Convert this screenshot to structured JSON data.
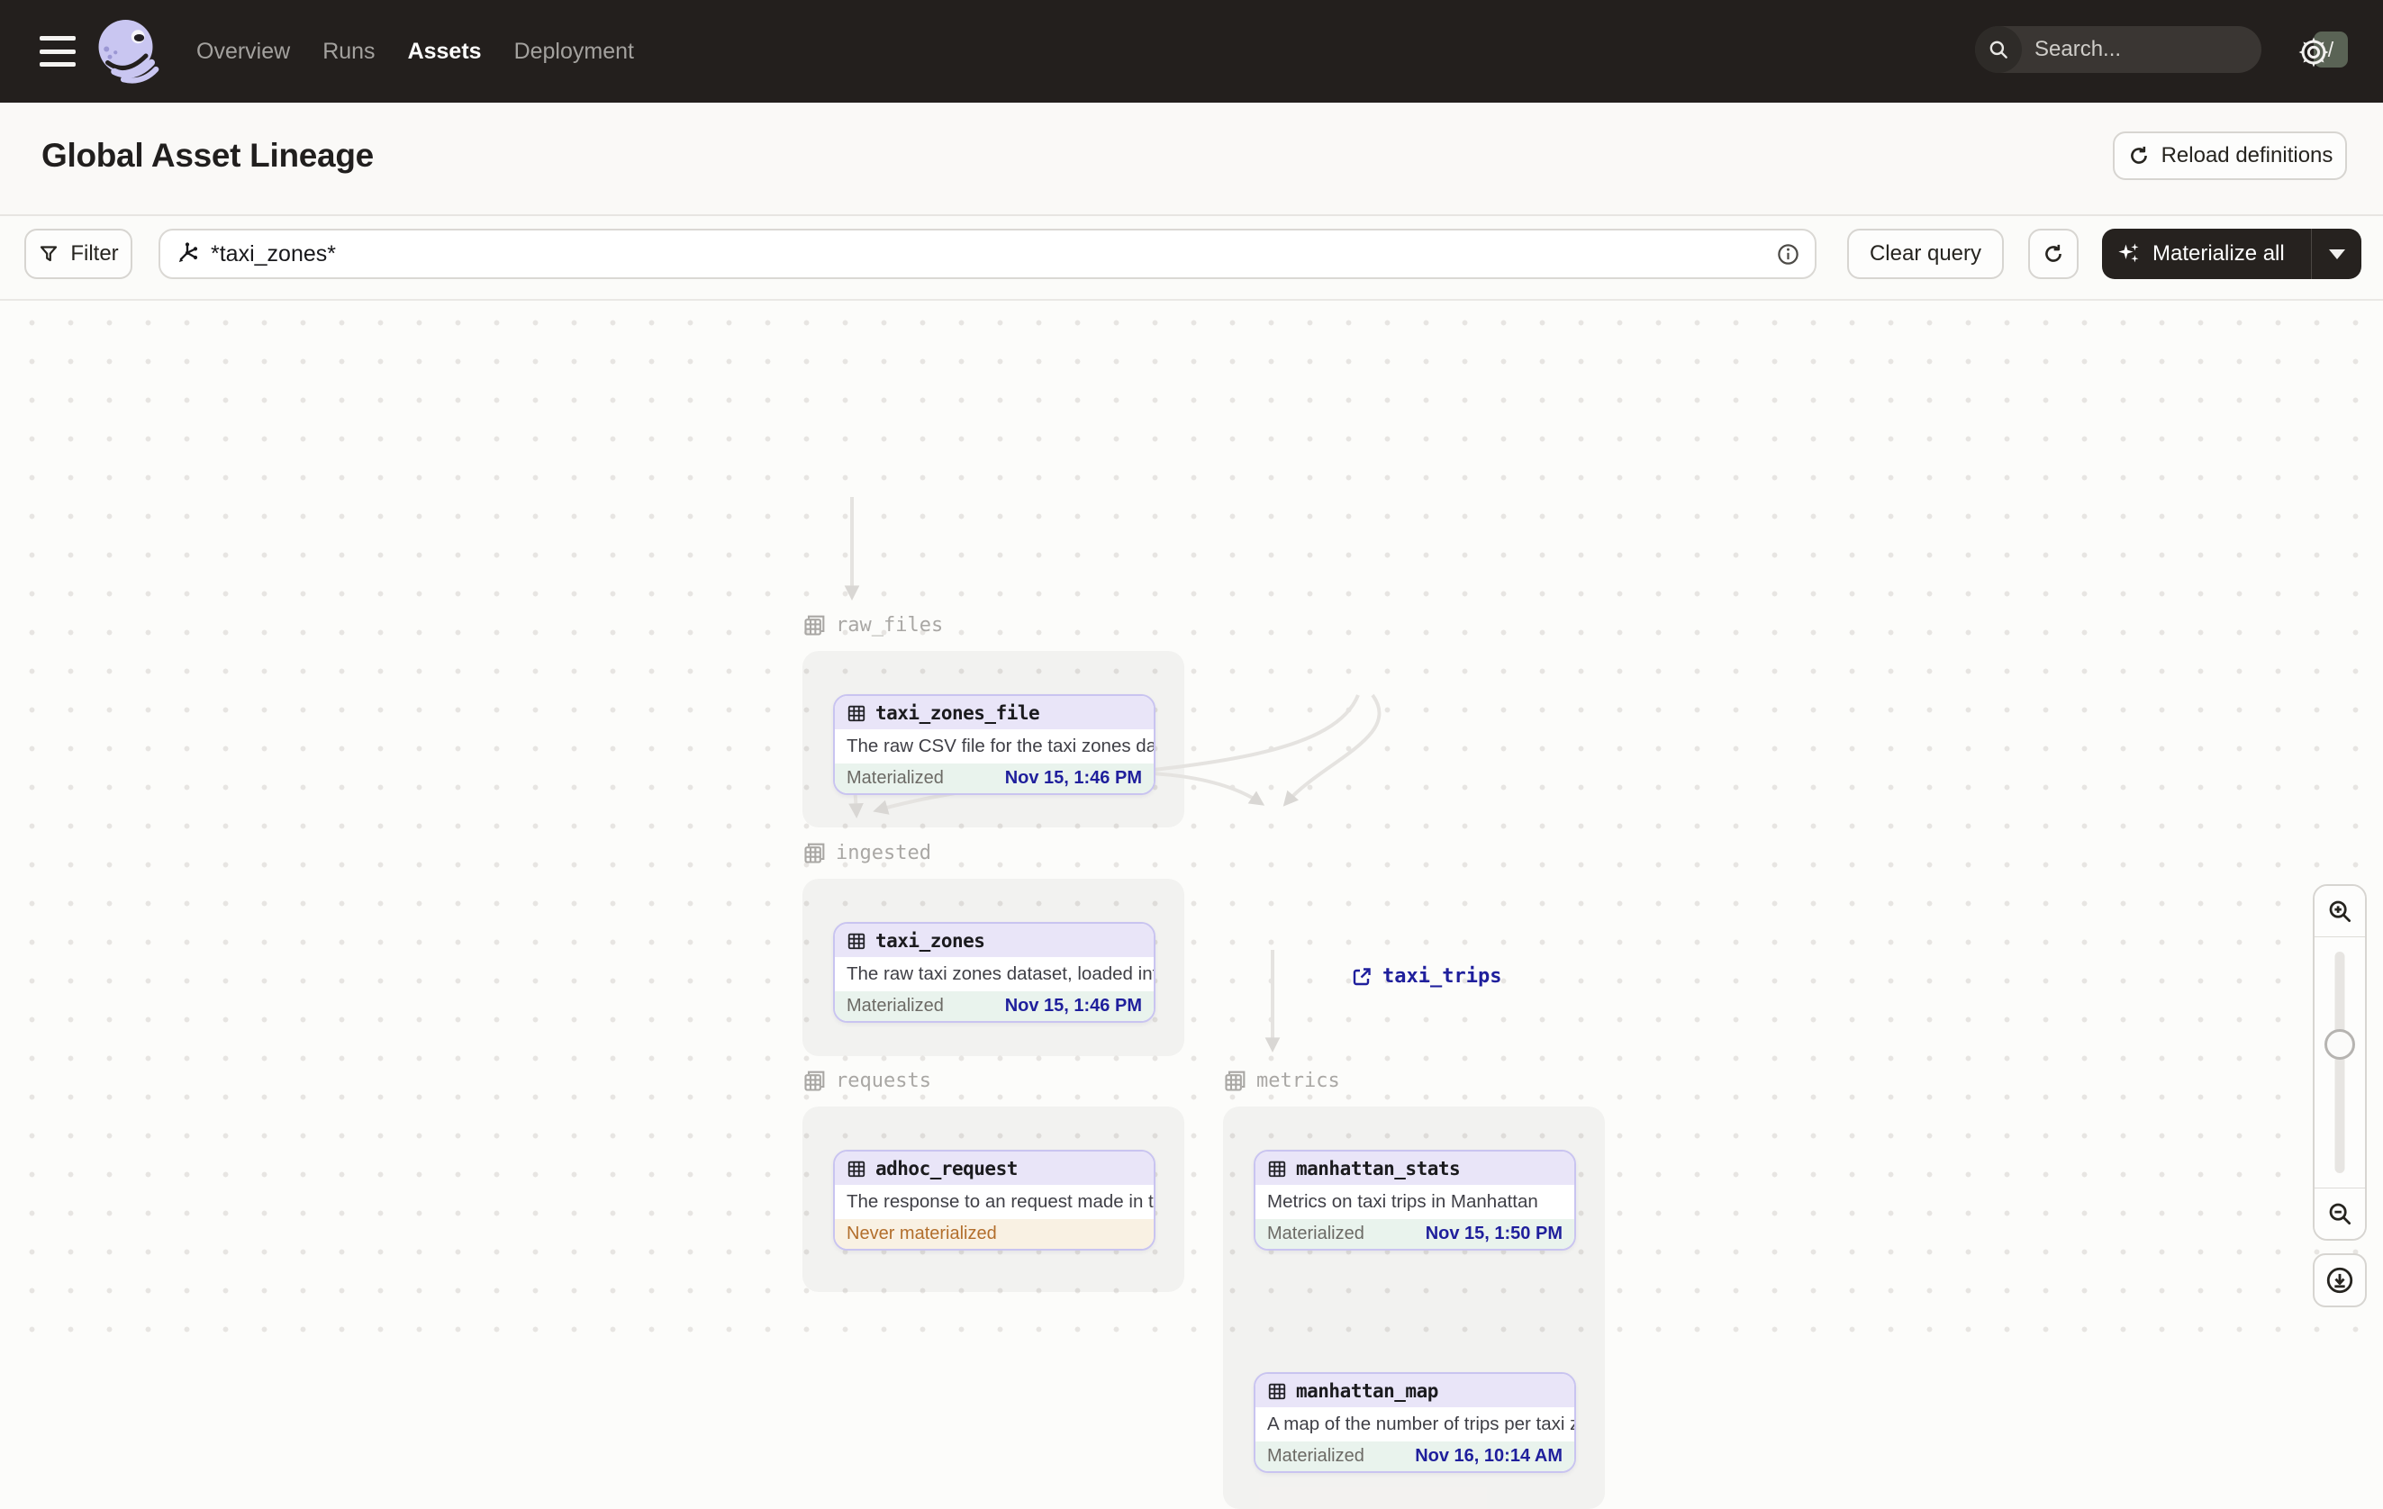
{
  "nav": {
    "items": [
      {
        "label": "Overview",
        "active": false
      },
      {
        "label": "Runs",
        "active": false
      },
      {
        "label": "Assets",
        "active": true
      },
      {
        "label": "Deployment",
        "active": false
      }
    ],
    "search": {
      "placeholder": "Search...",
      "shortcut_key": "/"
    }
  },
  "header": {
    "title": "Global Asset Lineage",
    "reload_button": "Reload definitions"
  },
  "toolbar": {
    "filter_button": "Filter",
    "query_value": "*taxi_zones*",
    "clear_button": "Clear query",
    "materialize_button": "Materialize all"
  },
  "graph": {
    "groups": [
      {
        "name": "raw_files"
      },
      {
        "name": "ingested"
      },
      {
        "name": "requests"
      },
      {
        "name": "metrics"
      }
    ],
    "nodes": [
      {
        "name": "taxi_zones_file",
        "group": "raw_files",
        "description": "The raw CSV file for the taxi zones dat...",
        "status": "Materialized",
        "timestamp": "Nov 15, 1:46 PM"
      },
      {
        "name": "taxi_zones",
        "group": "ingested",
        "description": "The raw taxi zones dataset, loaded int...",
        "status": "Materialized",
        "timestamp": "Nov 15, 1:46 PM"
      },
      {
        "name": "adhoc_request",
        "group": "requests",
        "description": "The response to an request made in th...",
        "status": "Never materialized",
        "timestamp": ""
      },
      {
        "name": "manhattan_stats",
        "group": "metrics",
        "description": "Metrics on taxi trips in Manhattan",
        "status": "Materialized",
        "timestamp": "Nov 15, 1:50 PM"
      },
      {
        "name": "manhattan_map",
        "group": "metrics",
        "description": "A map of the number of trips per taxi z...",
        "status": "Materialized",
        "timestamp": "Nov 16, 10:14 AM"
      }
    ],
    "external_assets": [
      {
        "name": "taxi_trips"
      }
    ]
  },
  "colors": {
    "nav_bg": "#231F1D",
    "node_border_purple": "#C9C4F0",
    "node_header_lavender": "#E9E5F8",
    "materialized_bg": "#E9F3ED",
    "never_materialized_bg": "#F9F1E3",
    "never_materialized_text": "#B26E2C",
    "timestamp_navy": "#1F1F9C",
    "edge_gray": "#E5E3E0"
  }
}
